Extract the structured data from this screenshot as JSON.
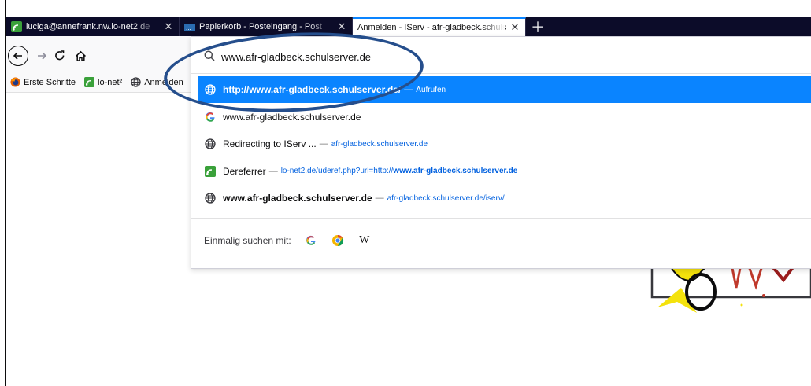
{
  "tabs": [
    {
      "title": "luciga@annefrank.nw.lo-net2.de",
      "icon": "lo-net-icon",
      "active": false
    },
    {
      "title": "Papierkorb - Posteingang - Post",
      "icon": "mail-icon",
      "active": false
    },
    {
      "title": "Anmelden - IServ - afr-gladbeck.schulserver.de",
      "icon": "none",
      "active": true
    }
  ],
  "toolbar": {
    "url_value": "www.afr-gladbeck.schulserver.de"
  },
  "bookmarks": [
    {
      "label": "Erste Schritte",
      "icon": "firefox-icon"
    },
    {
      "label": "lo-net²",
      "icon": "lo-net-icon"
    },
    {
      "label": "Anmelden",
      "icon": "globe-icon"
    }
  ],
  "results": [
    {
      "main_bold": "http://www.afr-gladbeck.schulserver.de/",
      "sub": "Aufrufen",
      "icon": "globe-icon",
      "selected": true
    },
    {
      "main": "www.afr-gladbeck.schulserver.de",
      "icon": "google-icon"
    },
    {
      "main": "Redirecting to IServ ...",
      "sub": "afr-gladbeck.schulserver.de",
      "icon": "globe-icon"
    },
    {
      "main": "Dereferrer",
      "sub_prefix": "lo-net2.de/uderef.php?url=http://",
      "sub_bold": "www.afr-gladbeck.schulserver.de",
      "icon": "lo-net-icon"
    },
    {
      "main_bold": "www.afr-gladbeck.schulserver.de",
      "sub": "afr-gladbeck.schulserver.de/iserv/",
      "icon": "globe-icon"
    }
  ],
  "oneoff": {
    "label": "Einmalig suchen mit:",
    "engines": [
      "google-icon",
      "chrome-like-icon",
      "wikipedia-icon"
    ],
    "wiki_letter": "W"
  },
  "colors": {
    "accent": "#0a84ff",
    "tabstrip": "#0c0c29",
    "annotation": "#254e8c"
  }
}
